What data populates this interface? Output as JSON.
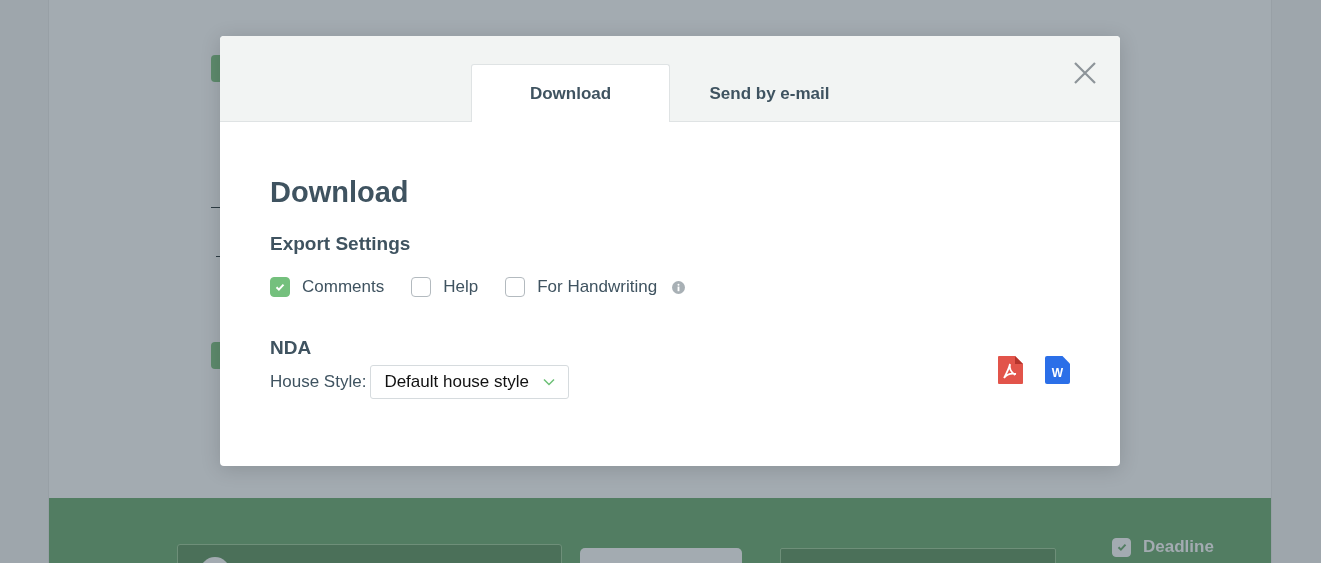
{
  "background": {
    "deadline": {
      "label": "Deadline",
      "checked": true
    }
  },
  "dialog": {
    "tabs": [
      {
        "label": "Download",
        "selected": true
      },
      {
        "label": "Send by e-mail",
        "selected": false
      }
    ],
    "title": "Download",
    "export_settings": {
      "heading": "Export Settings",
      "options": [
        {
          "label": "Comments",
          "checked": true,
          "info": false
        },
        {
          "label": "Help",
          "checked": false,
          "info": false
        },
        {
          "label": "For Handwriting",
          "checked": false,
          "info": true
        }
      ]
    },
    "document": {
      "name": "NDA",
      "house_style": {
        "label": "House Style:",
        "value": "Default house style"
      }
    },
    "formats": [
      {
        "kind": "pdf"
      },
      {
        "kind": "word",
        "letter": "W"
      }
    ]
  }
}
